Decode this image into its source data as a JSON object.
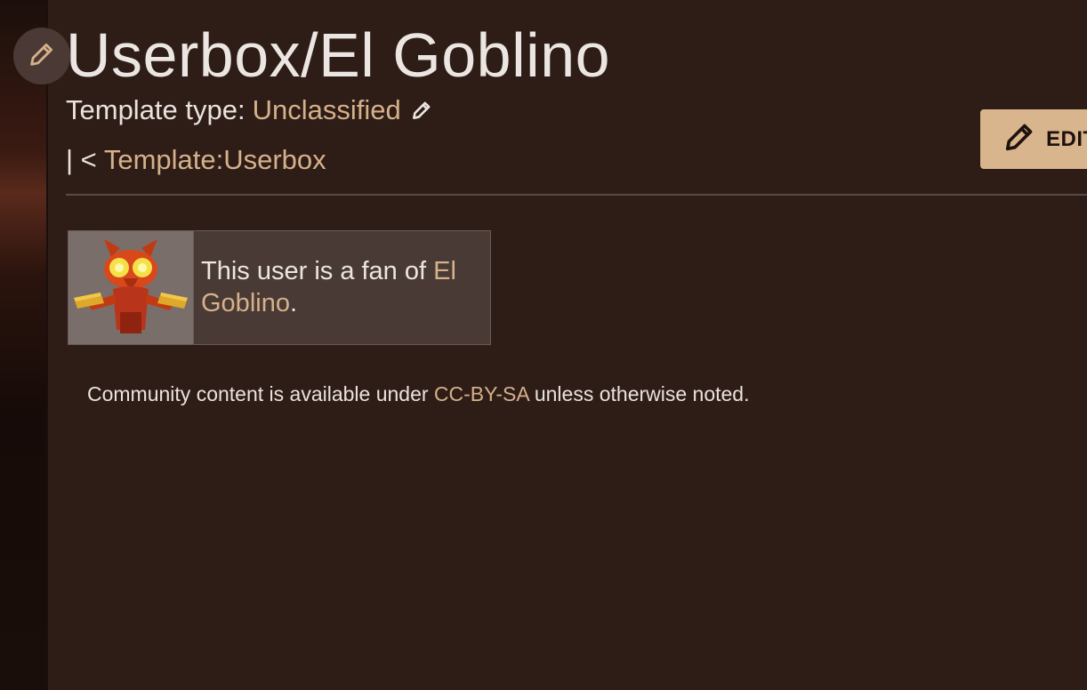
{
  "page": {
    "title": "Userbox/El Goblino",
    "template_type_label": "Template type: ",
    "template_type_value": "Unclassified",
    "breadcrumb_prefix": "| < ",
    "breadcrumb_link": "Template:Userbox"
  },
  "actions": {
    "edit_label": "EDIT",
    "edit_icon": "pencil-icon"
  },
  "userbox": {
    "image_name": "el-goblino-image",
    "text_prefix": "This user is a fan of ",
    "text_link": "El Goblino",
    "text_suffix": "."
  },
  "footer": {
    "prefix": "Community content is available under ",
    "license_link": "CC-BY-SA",
    "suffix": " unless otherwise noted."
  },
  "colors": {
    "background": "#2e1c17",
    "link": "#d5b18a",
    "edit_button": "#d8b58c",
    "text": "#ece6e2"
  }
}
